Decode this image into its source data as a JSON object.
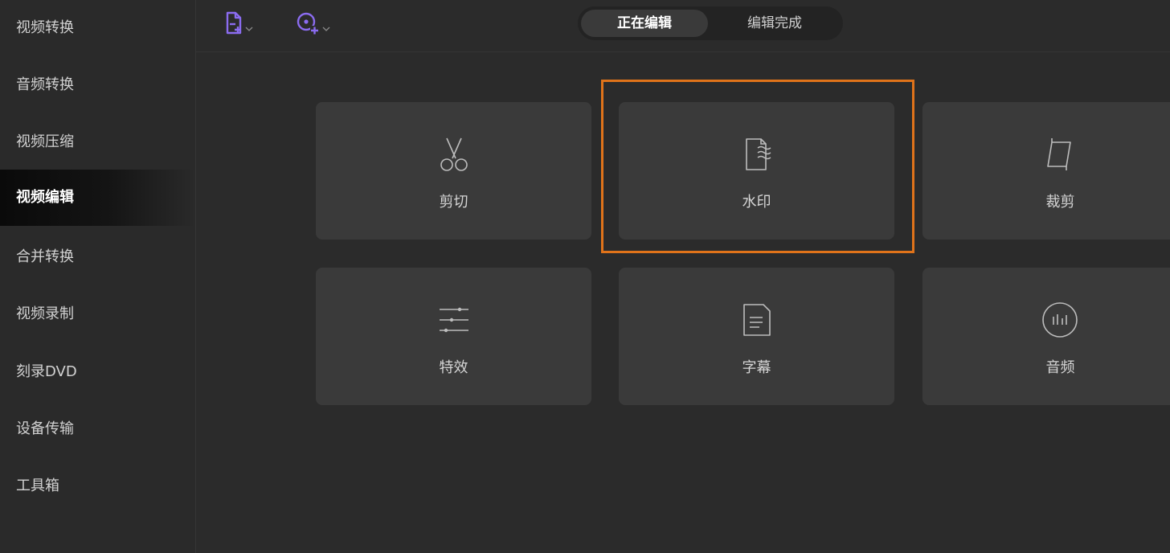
{
  "sidebar": {
    "items": [
      {
        "label": "视频转换"
      },
      {
        "label": "音频转换"
      },
      {
        "label": "视频压缩"
      },
      {
        "label": "视频编辑"
      },
      {
        "label": "合并转换"
      },
      {
        "label": "视频录制"
      },
      {
        "label": "刻录DVD"
      },
      {
        "label": "设备传输"
      },
      {
        "label": "工具箱"
      }
    ],
    "active_label": "视频编辑"
  },
  "toolbar": {
    "add_file_icon": "add-file-icon",
    "add_disc_icon": "add-disc-icon",
    "accent_color": "#8b6cf0"
  },
  "tabs": {
    "editing": "正在编辑",
    "completed": "编辑完成",
    "active": "正在编辑"
  },
  "cards": [
    {
      "label": "剪切",
      "icon": "scissors-icon"
    },
    {
      "label": "水印",
      "icon": "watermark-icon"
    },
    {
      "label": "裁剪",
      "icon": "crop-icon"
    },
    {
      "label": "特效",
      "icon": "effects-sliders-icon"
    },
    {
      "label": "字幕",
      "icon": "subtitle-icon"
    },
    {
      "label": "音频",
      "icon": "audio-icon"
    }
  ],
  "highlighted_card": "水印",
  "highlight_color": "#e0731a"
}
